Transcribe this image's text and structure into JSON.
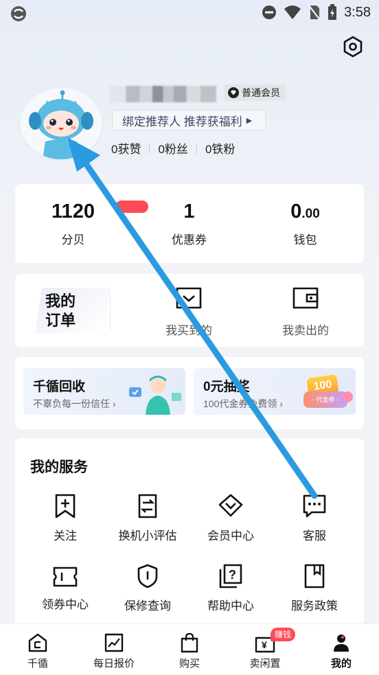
{
  "status_bar": {
    "time": "3:58"
  },
  "profile": {
    "member_label": "普通会员",
    "referrer_text": "绑定推荐人 推荐获福利",
    "stats": [
      {
        "label": "0获赞"
      },
      {
        "label": "0粉丝"
      },
      {
        "label": "0铁粉"
      }
    ]
  },
  "wallet": [
    {
      "value": "1120",
      "label": "分贝"
    },
    {
      "value": "1",
      "label": "优惠券"
    },
    {
      "value": "0",
      "decimal": ".00",
      "label": "钱包"
    }
  ],
  "orders": {
    "title": "我的订单",
    "title_line1": "我的",
    "title_line2": "订单",
    "items": [
      {
        "label": "我买到的",
        "icon": "bought-icon"
      },
      {
        "label": "我卖出的",
        "icon": "sold-wallet-icon"
      }
    ]
  },
  "promos": [
    {
      "title": "千循回收",
      "subtitle": "不辜负每一份信任 ›"
    },
    {
      "title": "0元抽奖",
      "subtitle": "100代金券免费领 ›",
      "coupon_value": "100",
      "coupon_label": "代金券"
    }
  ],
  "services": {
    "title": "我的服务",
    "items": [
      {
        "label": "关注",
        "icon": "bookmark-plus-icon"
      },
      {
        "label": "换机小评估",
        "icon": "exchange-icon"
      },
      {
        "label": "会员中心",
        "icon": "diamond-icon"
      },
      {
        "label": "客服",
        "icon": "chat-icon"
      },
      {
        "label": "领券中心",
        "icon": "ticket-icon"
      },
      {
        "label": "保修查询",
        "icon": "shield-icon"
      },
      {
        "label": "帮助中心",
        "icon": "help-icon"
      },
      {
        "label": "服务政策",
        "icon": "policy-icon"
      }
    ]
  },
  "tabbar": {
    "items": [
      {
        "label": "千循",
        "icon": "home-icon"
      },
      {
        "label": "每日报价",
        "icon": "chart-icon"
      },
      {
        "label": "购买",
        "icon": "bag-icon"
      },
      {
        "label": "卖闲置",
        "icon": "sell-icon"
      },
      {
        "label": "我的",
        "icon": "profile-icon"
      }
    ],
    "sell_badge": "赚钱",
    "active": "我的"
  },
  "colors": {
    "accent_red": "#ff4b55",
    "arrow_blue": "#2a9be0",
    "referrer_text": "#3a4a66"
  }
}
